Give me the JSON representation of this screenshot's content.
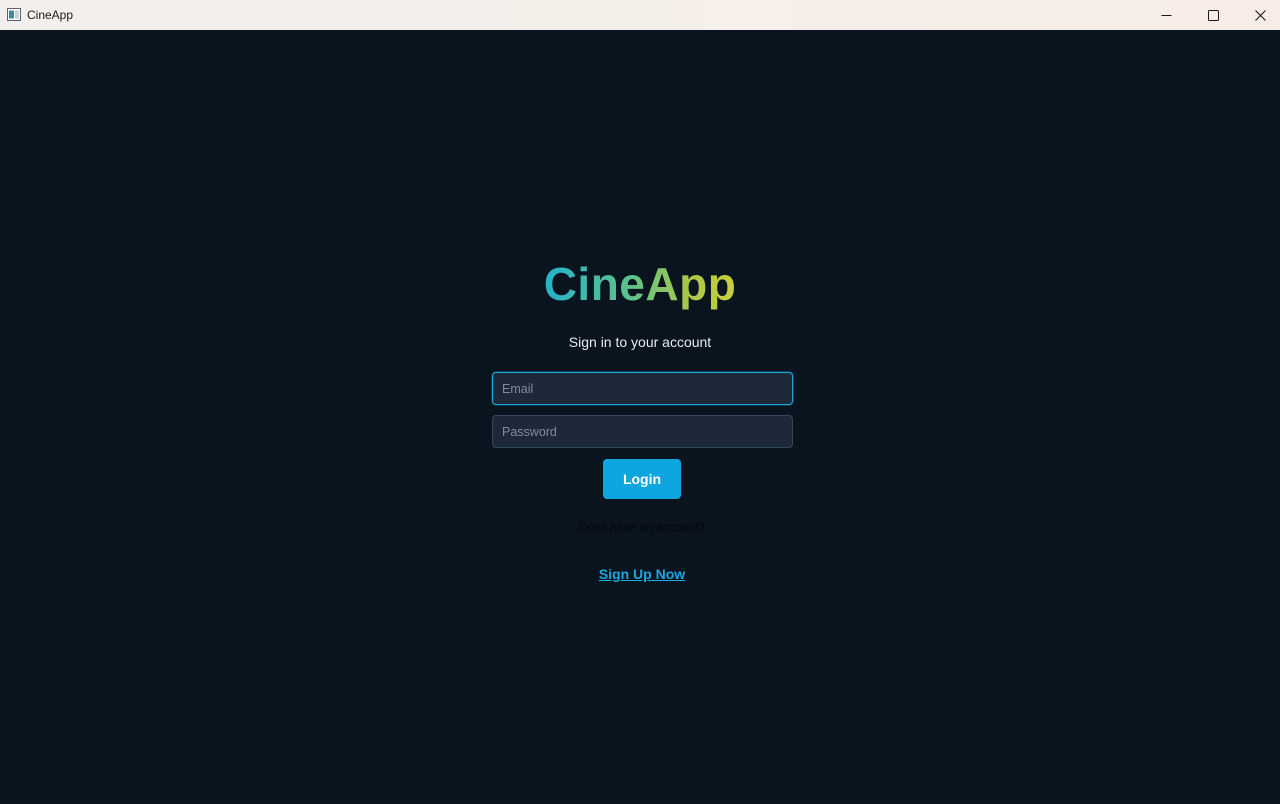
{
  "window": {
    "title": "CineApp",
    "controls": {
      "minimize": "minimize-icon",
      "maximize": "maximize-icon",
      "close": "close-icon"
    }
  },
  "login": {
    "logo_text": "CineApp",
    "subtitle": "Sign in to your account",
    "email_placeholder": "Email",
    "email_value": "",
    "password_placeholder": "Password",
    "password_value": "",
    "login_label": "Login",
    "no_account_text": "Don't have an account?",
    "signup_label": "Sign Up Now"
  },
  "colors": {
    "background": "#0a141e",
    "accent": "#0ea5e0",
    "logo_gradient_start": "#26b2c9",
    "logo_gradient_end": "#c9cf3a",
    "link": "#1aa7dd"
  }
}
